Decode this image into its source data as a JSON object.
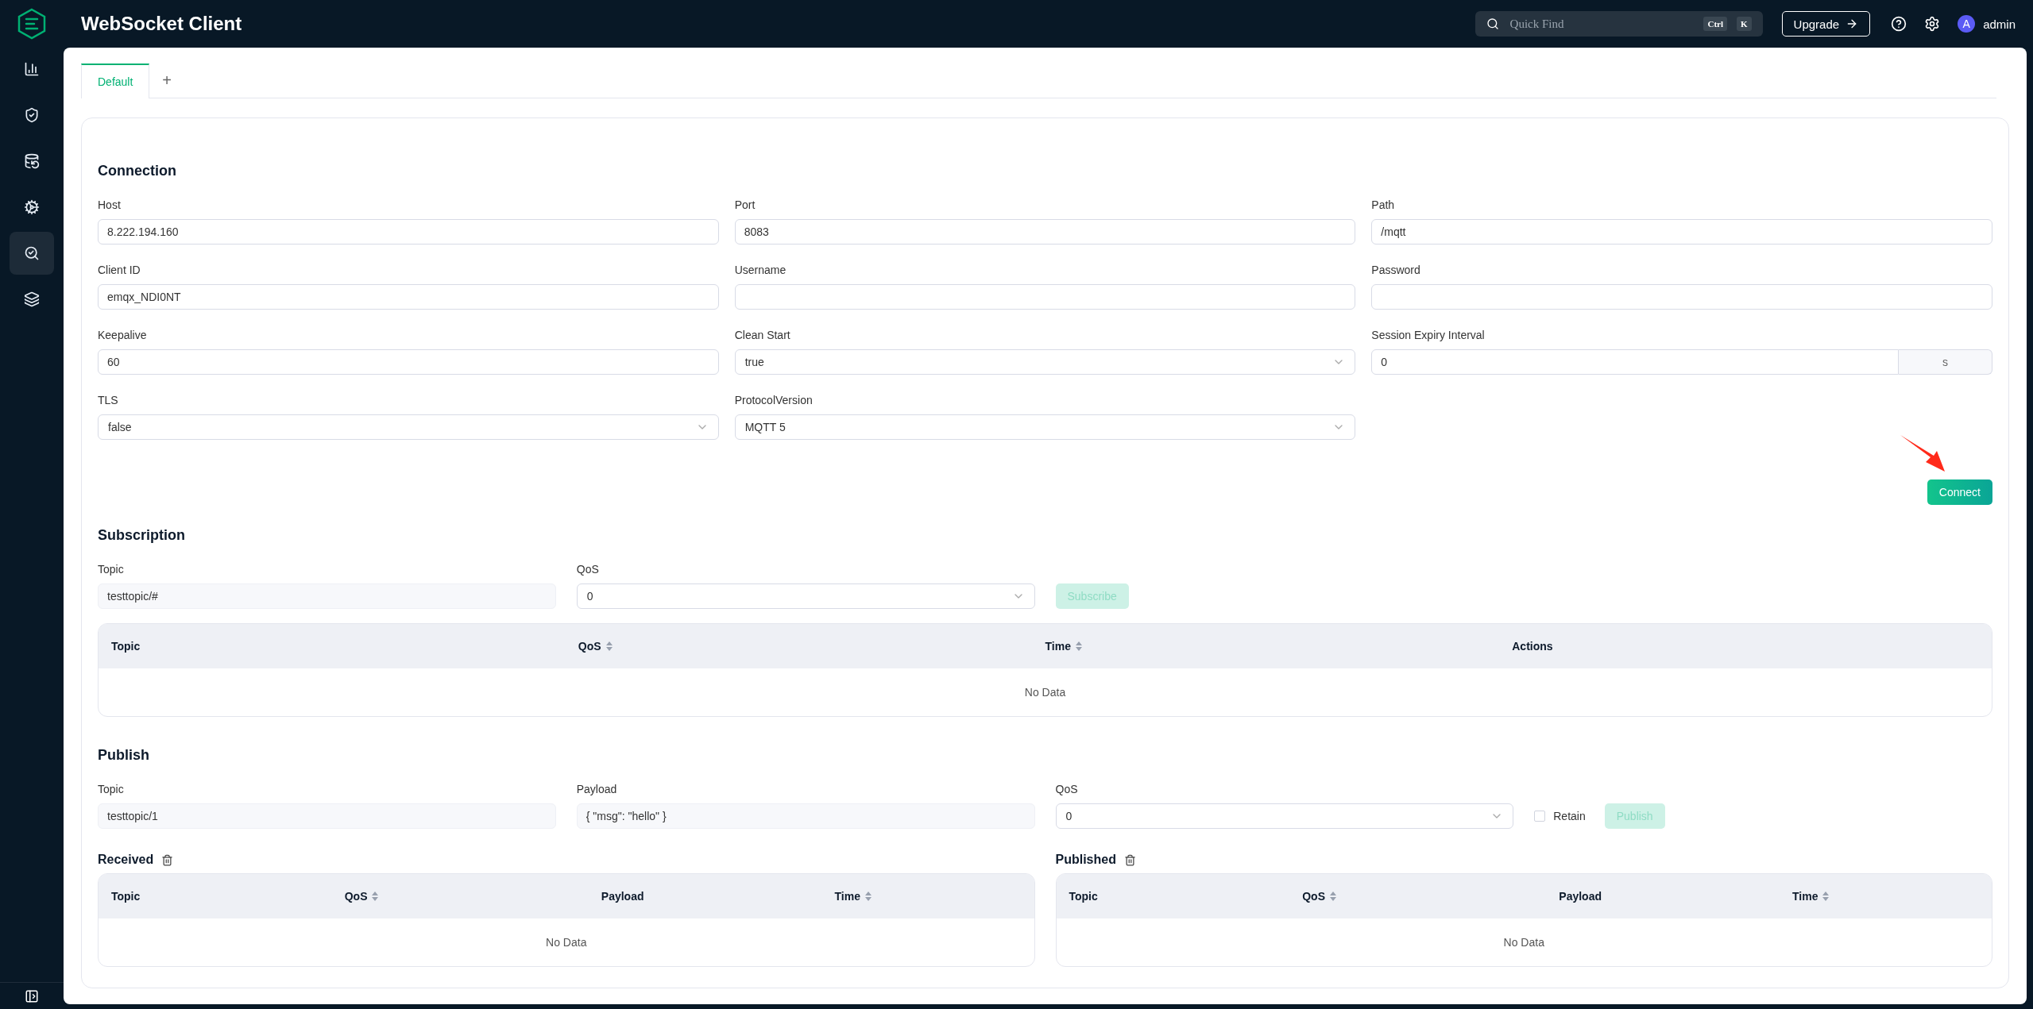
{
  "header": {
    "title": "WebSocket Client",
    "search": {
      "placeholder": "Quick Find",
      "keys": [
        "Ctrl",
        "K"
      ]
    },
    "upgrade": "Upgrade",
    "user": {
      "initial": "A",
      "name": "admin"
    }
  },
  "sidebar": {
    "items": [
      {
        "selected": false
      },
      {
        "selected": false
      },
      {
        "selected": false
      },
      {
        "selected": false
      },
      {
        "selected": true
      },
      {
        "selected": false
      }
    ]
  },
  "tabs": [
    {
      "label": "Default",
      "selected": true
    }
  ],
  "add_tab": "+",
  "connection": {
    "title": "Connection",
    "fields": [
      {
        "label": "Host",
        "kind": "input",
        "value": "8.222.194.160"
      },
      {
        "label": "Port",
        "kind": "input",
        "value": "8083"
      },
      {
        "label": "Path",
        "kind": "input",
        "value": "/mqtt"
      },
      {
        "label": "Client ID",
        "kind": "input",
        "value": "emqx_NDI0NT"
      },
      {
        "label": "Username",
        "kind": "input"
      },
      {
        "label": "Password",
        "kind": "input"
      },
      {
        "label": "Keepalive",
        "kind": "input",
        "value": "60"
      },
      {
        "label": "Clean Start",
        "kind": "select",
        "value": "true"
      },
      {
        "label": "Session Expiry Interval",
        "kind": "suffix",
        "value": "0",
        "suffix": "s"
      },
      {
        "label": "TLS",
        "kind": "select",
        "value": "false"
      },
      {
        "label": "ProtocolVersion",
        "kind": "select",
        "value": "MQTT 5"
      }
    ],
    "connect_button": "Connect"
  },
  "subscription": {
    "title": "Subscription",
    "topic": {
      "label": "Topic",
      "value": "testtopic/#",
      "disabled": true
    },
    "qos": {
      "label": "QoS",
      "value": "0",
      "disabled": false
    },
    "button": {
      "label": "Subscribe",
      "disabled": true
    },
    "table": {
      "columns": [
        {
          "label": "Topic",
          "sortable": false
        },
        {
          "label": "QoS",
          "sortable": true
        },
        {
          "label": "Time",
          "sortable": true
        },
        {
          "label": "Actions",
          "sortable": false
        }
      ],
      "empty": "No Data"
    }
  },
  "publish": {
    "title": "Publish",
    "topic": {
      "label": "Topic",
      "value": "testtopic/1",
      "disabled": true
    },
    "payload": {
      "label": "Payload",
      "value": "{ \"msg\": \"hello\" }",
      "disabled": true
    },
    "qos": {
      "label": "QoS",
      "value": "0",
      "disabled": false
    },
    "retain": {
      "label": "Retain",
      "checked": false
    },
    "button": {
      "label": "Publish",
      "disabled": true
    }
  },
  "received": {
    "title": "Received",
    "table": {
      "columns": [
        {
          "label": "Topic",
          "sortable": false
        },
        {
          "label": "QoS",
          "sortable": true
        },
        {
          "label": "Payload",
          "sortable": false
        },
        {
          "label": "Time",
          "sortable": true
        }
      ],
      "empty": "No Data"
    }
  },
  "published": {
    "title": "Published",
    "table": {
      "columns": [
        {
          "label": "Topic",
          "sortable": false
        },
        {
          "label": "QoS",
          "sortable": true
        },
        {
          "label": "Payload",
          "sortable": false
        },
        {
          "label": "Time",
          "sortable": true
        }
      ],
      "empty": "No Data"
    }
  }
}
